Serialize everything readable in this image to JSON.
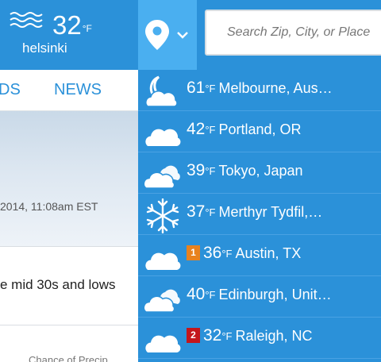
{
  "current": {
    "temp": "32",
    "unit": "°F",
    "city": "helsinki",
    "icon": "wind-icon"
  },
  "location_button": {
    "icon": "location-pin-icon",
    "chevron": "chevron-down-icon"
  },
  "search": {
    "placeholder": "Search Zip, City, or Place"
  },
  "nav": {
    "tab_partial": "DS",
    "tab_news": "NEWS"
  },
  "background": {
    "timestamp": "2014, 11:08am EST",
    "forecast_text": "e mid 30s and lows",
    "precip_label": "Chance of Precip"
  },
  "locations": [
    {
      "temp": "61",
      "unit": "°F",
      "name": "Melbourne, Aus…",
      "icon": "night-cloudy-icon",
      "alert": "",
      "alert_color": ""
    },
    {
      "temp": "42",
      "unit": "°F",
      "name": "Portland, OR",
      "icon": "cloud-icon",
      "alert": "",
      "alert_color": ""
    },
    {
      "temp": "39",
      "unit": "°F",
      "name": "Tokyo, Japan",
      "icon": "partly-cloudy-icon",
      "alert": "",
      "alert_color": ""
    },
    {
      "temp": "37",
      "unit": "°F",
      "name": "Merthyr Tydfil,…",
      "icon": "snowflake-icon",
      "alert": "",
      "alert_color": ""
    },
    {
      "temp": "36",
      "unit": "°F",
      "name": "Austin, TX",
      "icon": "cloud-icon",
      "alert": "1",
      "alert_color": "#e8821e"
    },
    {
      "temp": "40",
      "unit": "°F",
      "name": "Edinburgh, Unit…",
      "icon": "partly-cloudy-icon",
      "alert": "",
      "alert_color": ""
    },
    {
      "temp": "32",
      "unit": "°F",
      "name": "Raleigh, NC",
      "icon": "cloud-icon",
      "alert": "2",
      "alert_color": "#c4161c"
    }
  ],
  "colors": {
    "header_blue": "#2b91d9",
    "pin_button_blue": "#4aaff0",
    "nav_text_blue": "#2b91d9"
  }
}
